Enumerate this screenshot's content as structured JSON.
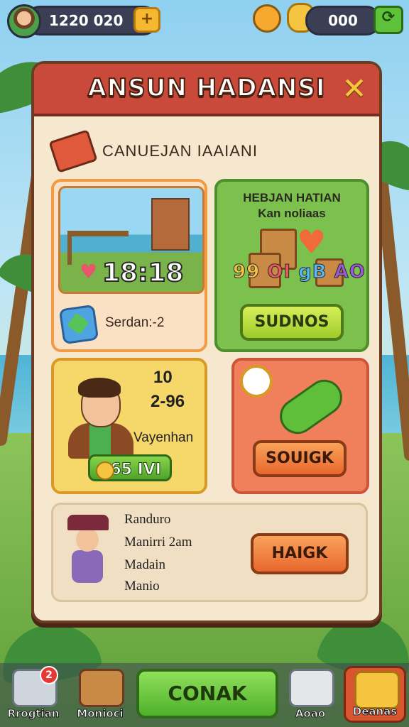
{
  "hud": {
    "coins": "1220 020",
    "coins_plus_icon": "plus-icon",
    "gems": "000",
    "refresh_icon": "refresh-icon"
  },
  "panel": {
    "title": "ANSUN HADANSI",
    "section_label": "CANUEJAN IAAIANI",
    "cards": {
      "timer_card": {
        "time": "18:18",
        "label": "Serdan:-2"
      },
      "shop_card": {
        "title_line1": "HEBJAN HATIAN",
        "title_line2": "Kan noliaas",
        "colorful_text": [
          "99",
          "OI",
          "gB",
          "AO"
        ],
        "button": "SUDNOS"
      },
      "character_card": {
        "stat1": "10",
        "stat2": "2-96",
        "name": "Vayenhan",
        "coin_button": "365 IVI"
      },
      "item_card": {
        "button": "SOUIGK"
      },
      "info_card": {
        "lines": [
          "Randuro",
          "Manirri 2am",
          "Madain",
          "Manio"
        ],
        "button": "HAIGK"
      }
    }
  },
  "bottom_nav": {
    "items": [
      {
        "label": "Rrogtian",
        "badge": "2"
      },
      {
        "label": "Monioci"
      },
      {
        "label": "Aoao"
      },
      {
        "label": "Deanas"
      }
    ],
    "main_button": "CONAK"
  },
  "colors": {
    "header_red": "#c94a3a",
    "panel_bg": "#f6e7cf",
    "green_button": "#9fcc2a",
    "orange_button": "#e8672e"
  }
}
